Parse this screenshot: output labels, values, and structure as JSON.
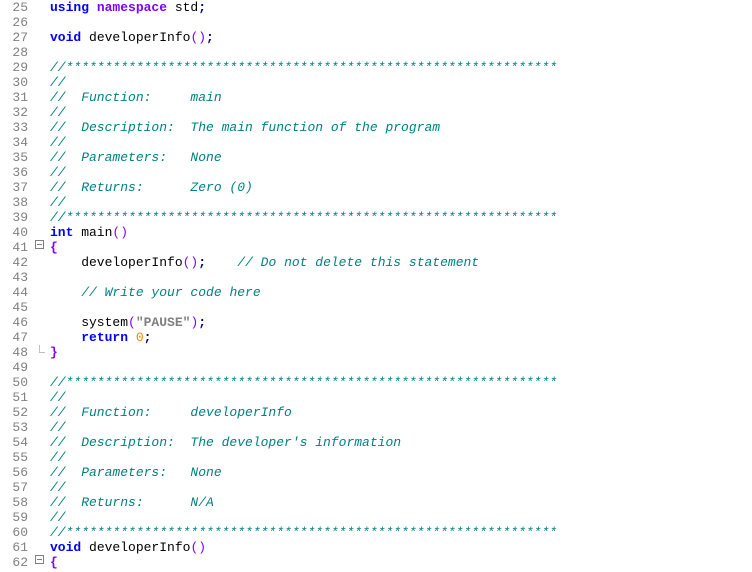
{
  "lines": [
    {
      "n": 25,
      "fold": "",
      "tokens": [
        [
          "kw",
          "using "
        ],
        [
          "type",
          "namespace"
        ],
        [
          "ident",
          " std"
        ],
        [
          "punc",
          ";"
        ]
      ]
    },
    {
      "n": 26,
      "fold": "",
      "tokens": []
    },
    {
      "n": 27,
      "fold": "",
      "tokens": [
        [
          "kw",
          "void"
        ],
        [
          "ident",
          " developerInfo"
        ],
        [
          "paren",
          "()"
        ],
        [
          "punc",
          ";"
        ]
      ]
    },
    {
      "n": 28,
      "fold": "",
      "tokens": []
    },
    {
      "n": 29,
      "fold": "",
      "tokens": [
        [
          "comment",
          "//***************************************************************"
        ]
      ]
    },
    {
      "n": 30,
      "fold": "",
      "tokens": [
        [
          "comment",
          "//"
        ]
      ]
    },
    {
      "n": 31,
      "fold": "",
      "tokens": [
        [
          "comment",
          "//  Function:     main"
        ]
      ]
    },
    {
      "n": 32,
      "fold": "",
      "tokens": [
        [
          "comment",
          "//"
        ]
      ]
    },
    {
      "n": 33,
      "fold": "",
      "tokens": [
        [
          "comment",
          "//  Description:  The main function of the program"
        ]
      ]
    },
    {
      "n": 34,
      "fold": "",
      "tokens": [
        [
          "comment",
          "//"
        ]
      ]
    },
    {
      "n": 35,
      "fold": "",
      "tokens": [
        [
          "comment",
          "//  Parameters:   None"
        ]
      ]
    },
    {
      "n": 36,
      "fold": "",
      "tokens": [
        [
          "comment",
          "//"
        ]
      ]
    },
    {
      "n": 37,
      "fold": "",
      "tokens": [
        [
          "comment",
          "//  Returns:      Zero (0)"
        ]
      ]
    },
    {
      "n": 38,
      "fold": "",
      "tokens": [
        [
          "comment",
          "//"
        ]
      ]
    },
    {
      "n": 39,
      "fold": "",
      "tokens": [
        [
          "comment",
          "//***************************************************************"
        ]
      ]
    },
    {
      "n": 40,
      "fold": "",
      "tokens": [
        [
          "kw",
          "int"
        ],
        [
          "ident",
          " main"
        ],
        [
          "paren",
          "()"
        ]
      ]
    },
    {
      "n": 41,
      "fold": "open",
      "tokens": [
        [
          "brace",
          "{"
        ]
      ]
    },
    {
      "n": 42,
      "fold": "mid",
      "tokens": [
        [
          "ident",
          "    developerInfo"
        ],
        [
          "paren",
          "()"
        ],
        [
          "punc",
          ";"
        ],
        [
          "ident",
          "    "
        ],
        [
          "comment",
          "// Do not delete this statement"
        ]
      ]
    },
    {
      "n": 43,
      "fold": "mid",
      "tokens": []
    },
    {
      "n": 44,
      "fold": "mid",
      "tokens": [
        [
          "ident",
          "    "
        ],
        [
          "comment",
          "// Write your code here"
        ]
      ]
    },
    {
      "n": 45,
      "fold": "mid",
      "tokens": []
    },
    {
      "n": 46,
      "fold": "mid",
      "tokens": [
        [
          "ident",
          "    system"
        ],
        [
          "paren",
          "("
        ],
        [
          "str",
          "\"PAUSE\""
        ],
        [
          "paren",
          ")"
        ],
        [
          "punc",
          ";"
        ]
      ]
    },
    {
      "n": 47,
      "fold": "mid",
      "tokens": [
        [
          "ident",
          "    "
        ],
        [
          "kw",
          "return"
        ],
        [
          "ident",
          " "
        ],
        [
          "num",
          "0"
        ],
        [
          "punc",
          ";"
        ]
      ]
    },
    {
      "n": 48,
      "fold": "close",
      "tokens": [
        [
          "brace",
          "}"
        ]
      ]
    },
    {
      "n": 49,
      "fold": "",
      "tokens": []
    },
    {
      "n": 50,
      "fold": "",
      "tokens": [
        [
          "comment",
          "//***************************************************************"
        ]
      ]
    },
    {
      "n": 51,
      "fold": "",
      "tokens": [
        [
          "comment",
          "//"
        ]
      ]
    },
    {
      "n": 52,
      "fold": "",
      "tokens": [
        [
          "comment",
          "//  Function:     developerInfo"
        ]
      ]
    },
    {
      "n": 53,
      "fold": "",
      "tokens": [
        [
          "comment",
          "//"
        ]
      ]
    },
    {
      "n": 54,
      "fold": "",
      "tokens": [
        [
          "comment",
          "//  Description:  The developer's information"
        ]
      ]
    },
    {
      "n": 55,
      "fold": "",
      "tokens": [
        [
          "comment",
          "//"
        ]
      ]
    },
    {
      "n": 56,
      "fold": "",
      "tokens": [
        [
          "comment",
          "//  Parameters:   None"
        ]
      ]
    },
    {
      "n": 57,
      "fold": "",
      "tokens": [
        [
          "comment",
          "//"
        ]
      ]
    },
    {
      "n": 58,
      "fold": "",
      "tokens": [
        [
          "comment",
          "//  Returns:      N/A"
        ]
      ]
    },
    {
      "n": 59,
      "fold": "",
      "tokens": [
        [
          "comment",
          "//"
        ]
      ]
    },
    {
      "n": 60,
      "fold": "",
      "tokens": [
        [
          "comment",
          "//***************************************************************"
        ]
      ]
    },
    {
      "n": 61,
      "fold": "",
      "tokens": [
        [
          "kw",
          "void"
        ],
        [
          "ident",
          " developerInfo"
        ],
        [
          "paren",
          "()"
        ]
      ]
    },
    {
      "n": 62,
      "fold": "open",
      "tokens": [
        [
          "brace",
          "{"
        ]
      ]
    }
  ]
}
